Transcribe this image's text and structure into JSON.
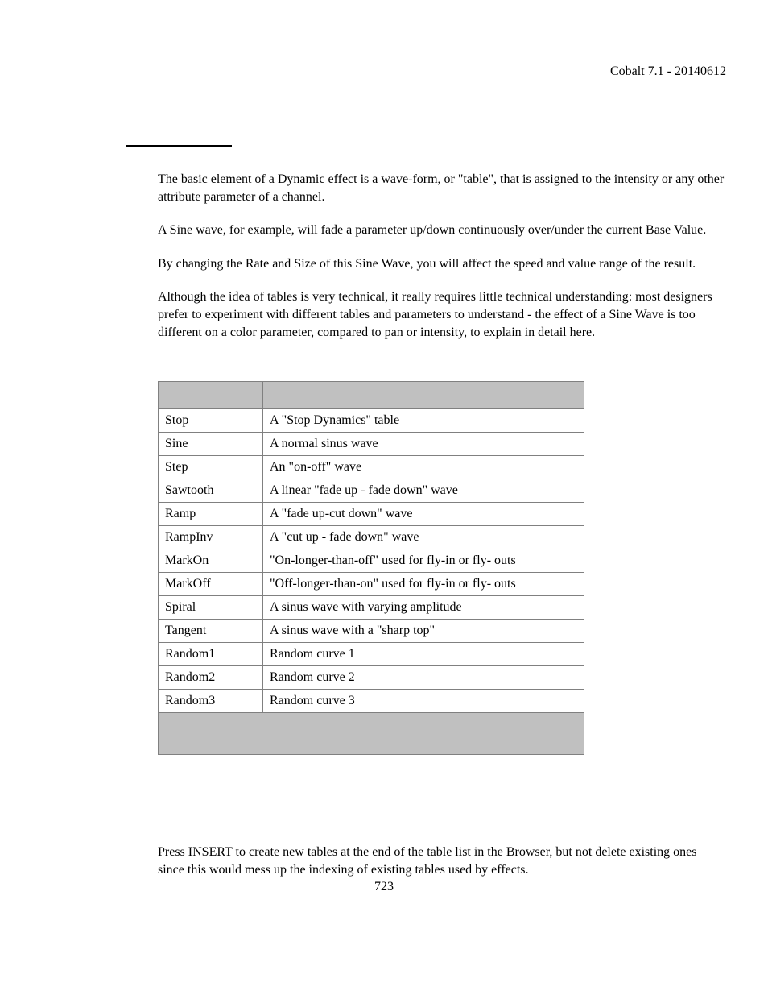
{
  "header": {
    "right": "Cobalt 7.1 - 20140612"
  },
  "intro": {
    "p1": "The basic element of a Dynamic effect is a wave-form, or \"table\", that is assigned to the intensity or any other attribute parameter of a channel.",
    "p2": "A Sine wave, for example, will fade a parameter up/down continuously over/under the current Base Value.",
    "p3": "By changing the Rate and Size of this Sine Wave, you will affect the speed and value range of the result.",
    "p4": "Although the idea of tables is very technical, it really requires little technical understanding: most designers prefer to experiment with different tables and parameters to understand - the effect of a Sine Wave is too different on a color parameter, compared to pan or intensity, to explain in detail here."
  },
  "table": {
    "rows": [
      {
        "name": "Stop",
        "desc": "A \"Stop Dynamics\" table"
      },
      {
        "name": "Sine",
        "desc": "A normal sinus wave"
      },
      {
        "name": "Step",
        "desc": "An \"on-off\" wave"
      },
      {
        "name": "Sawtooth",
        "desc": "A linear \"fade up - fade down\" wave"
      },
      {
        "name": "Ramp",
        "desc": "A \"fade up-cut down\" wave"
      },
      {
        "name": "RampInv",
        "desc": "A \"cut up - fade down\" wave"
      },
      {
        "name": "MarkOn",
        "desc": "\"On-longer-than-off\" used for fly-in or fly- outs"
      },
      {
        "name": "MarkOff",
        "desc": "\"Off-longer-than-on\" used for fly-in or fly- outs"
      },
      {
        "name": "Spiral",
        "desc": "A sinus wave with varying amplitude"
      },
      {
        "name": "Tangent",
        "desc": "A sinus wave with a \"sharp top\""
      },
      {
        "name": "Random1",
        "desc": "Random curve 1"
      },
      {
        "name": "Random2",
        "desc": "Random curve 2"
      },
      {
        "name": "Random3",
        "desc": "Random curve 3"
      }
    ]
  },
  "outro": {
    "p1": "Press INSERT to create new tables at the end  of the table list in the Browser, but not delete existing ones since this would mess up the indexing of existing tables used by effects."
  },
  "page_number": "723"
}
